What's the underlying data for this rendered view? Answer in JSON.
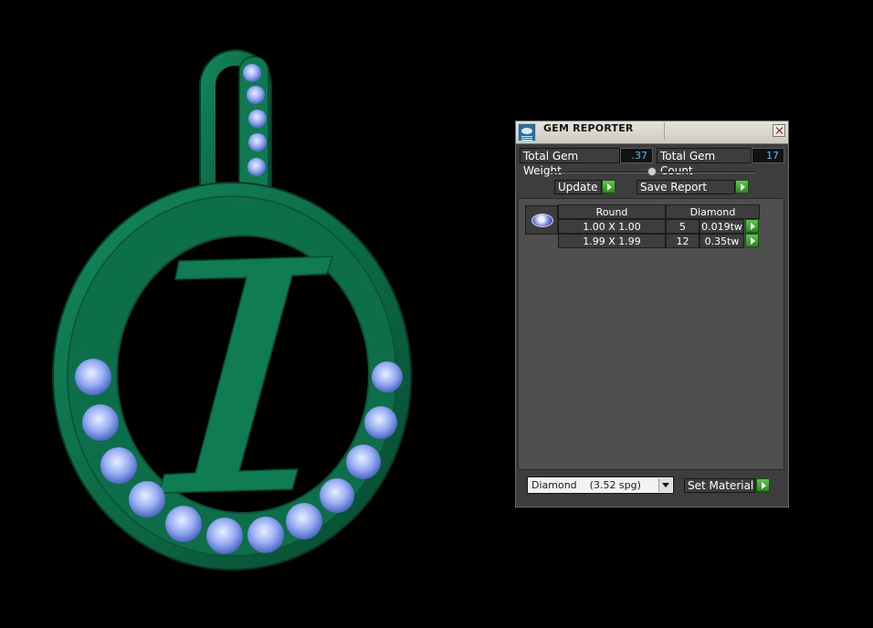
{
  "panel": {
    "title": "GEM REPORTER",
    "total_weight_label": "Total Gem Weight",
    "total_weight_value": ".37",
    "total_count_label": "Total Gem Count",
    "total_count_value": "17",
    "update_label": "Update",
    "save_report_label": "Save Report",
    "table": {
      "shape_header": "Round",
      "material_header": "Diamond",
      "rows": [
        {
          "size": "1.00 X 1.00",
          "count": "5",
          "weight": "0.019tw"
        },
        {
          "size": "1.99 X 1.99",
          "count": "12",
          "weight": "0.35tw"
        }
      ]
    },
    "material_select_value": "Diamond    (3.52 spg)",
    "set_material_label": "Set Material"
  },
  "colors": {
    "metal": "#0e6b4a",
    "gem": "#8fa6f0",
    "accent_button": "#3aa12e",
    "value_text": "#4fb7ff"
  },
  "icons": [
    "gem-reporter-app-icon",
    "close-icon",
    "go-arrow-icon",
    "round-stone-icon",
    "chevron-down-icon"
  ]
}
